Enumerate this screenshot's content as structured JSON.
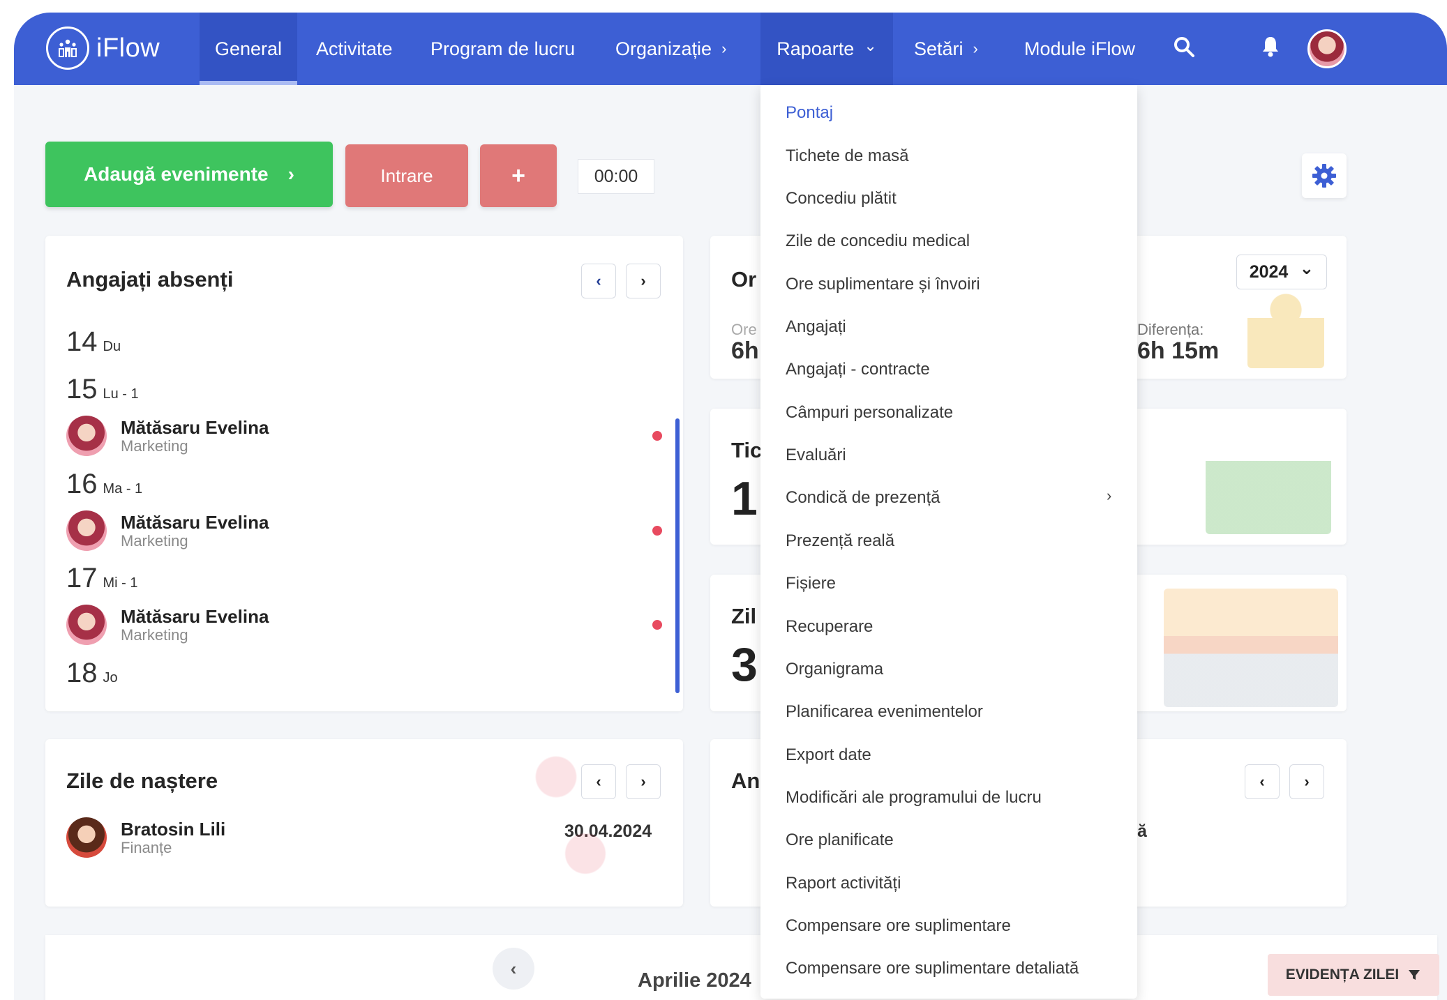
{
  "brand": {
    "name": "iFlow"
  },
  "nav": {
    "items": [
      {
        "label": "General"
      },
      {
        "label": "Activitate"
      },
      {
        "label": "Program de lucru"
      },
      {
        "label": "Organizație"
      },
      {
        "label": "Rapoarte"
      },
      {
        "label": "Setări"
      },
      {
        "label": "Module iFlow"
      }
    ],
    "chevron_right": "›",
    "chevron_down": "⌄"
  },
  "toolbar": {
    "add_events_label": "Adaugă evenimente",
    "add_events_chevron": "›",
    "entry_label": "Intrare",
    "plus_label": "+",
    "timer_value": "00:00"
  },
  "absent": {
    "title": "Angajați absenți",
    "prev": "‹",
    "next": "›",
    "days": [
      {
        "num": "14",
        "label": "Du"
      },
      {
        "num": "15",
        "label": "Lu - 1"
      },
      {
        "num": "16",
        "label": "Ma - 1"
      },
      {
        "num": "17",
        "label": "Mi - 1"
      },
      {
        "num": "18",
        "label": "Jo"
      }
    ],
    "people": [
      {
        "name": "Mătăsaru Evelina",
        "dept": "Marketing"
      },
      {
        "name": "Mătăsaru Evelina",
        "dept": "Marketing"
      },
      {
        "name": "Mătăsaru Evelina",
        "dept": "Marketing"
      }
    ]
  },
  "hours_card": {
    "title_partial": "Or",
    "label_partial": "Ore",
    "value_partial": "6h",
    "diff_label_partial": "Diferența:",
    "diff_value": "6h 15m",
    "year": "2024"
  },
  "tickets_card": {
    "title_partial": "Tic",
    "value_partial": "1"
  },
  "vacation_card": {
    "title_partial": "Zil",
    "value_partial": "3"
  },
  "anniversary_card": {
    "title_partial": "An",
    "prev": "‹",
    "next": "›",
    "text_partial": "ă"
  },
  "birthdays": {
    "title": "Zile de naștere",
    "prev": "‹",
    "next": "›",
    "person": {
      "name": "Bratosin Lili",
      "dept": "Finanțe",
      "date": "30.04.2024"
    }
  },
  "calendar_bar": {
    "prev": "‹",
    "month": "Aprilie 2024",
    "filter_label": "EVIDENȚA ZILEI"
  },
  "rapoarte_menu": {
    "items": [
      {
        "label": "Pontaj"
      },
      {
        "label": "Tichete de masă"
      },
      {
        "label": "Concediu plătit"
      },
      {
        "label": "Zile de concediu medical"
      },
      {
        "label": "Ore suplimentare și învoiri"
      },
      {
        "label": "Angajați"
      },
      {
        "label": "Angajați - contracte"
      },
      {
        "label": "Câmpuri personalizate"
      },
      {
        "label": "Evaluări"
      },
      {
        "label": "Condică de prezență"
      },
      {
        "label": "Prezență reală"
      },
      {
        "label": "Fișiere"
      },
      {
        "label": "Recuperare"
      },
      {
        "label": "Organigrama"
      },
      {
        "label": "Planificarea evenimentelor"
      },
      {
        "label": "Export date"
      },
      {
        "label": "Modificări ale programului de lucru"
      },
      {
        "label": "Ore planificate"
      },
      {
        "label": "Raport activități"
      },
      {
        "label": "Compensare ore suplimentare"
      },
      {
        "label": "Compensare ore suplimentare detaliată"
      }
    ],
    "submenu_chevron": "›"
  },
  "colors": {
    "nav": "#3d5fd4",
    "green": "#3ec45e",
    "red": "#e07878",
    "dot": "#e84a5f"
  }
}
